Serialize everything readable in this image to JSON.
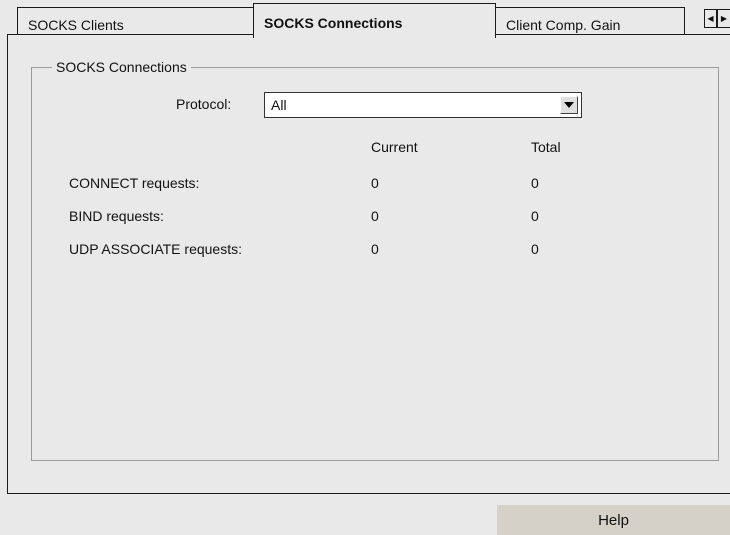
{
  "tabs": [
    {
      "label": "SOCKS Clients"
    },
    {
      "label": "SOCKS Connections"
    },
    {
      "label": "Client Comp. Gain"
    }
  ],
  "tab_nav": {
    "left_icon": "arrow-left-icon",
    "right_icon": "arrow-right-icon"
  },
  "group": {
    "title": "SOCKS Connections"
  },
  "protocol": {
    "label": "Protocol:",
    "value": "All"
  },
  "table": {
    "columns": [
      "Current",
      "Total"
    ],
    "rows": [
      {
        "label": "CONNECT requests:",
        "current": "0",
        "total": "0"
      },
      {
        "label": "BIND requests:",
        "current": "0",
        "total": "0"
      },
      {
        "label": "UDP ASSOCIATE requests:",
        "current": "0",
        "total": "0"
      }
    ]
  },
  "footer": {
    "help_label": "Help"
  }
}
